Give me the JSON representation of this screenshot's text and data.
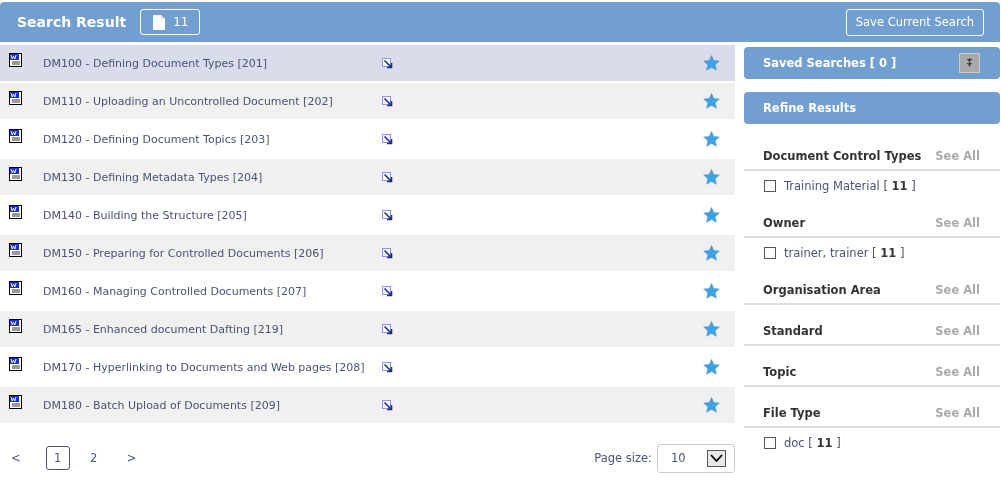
{
  "header": {
    "title": "Search Result",
    "count": "11",
    "save_button": "Save Current Search"
  },
  "results": [
    {
      "title": "DM100 - Defining Document Types [201]",
      "selected": true
    },
    {
      "title": "DM110 - Uploading an Uncontrolled Document [202]",
      "selected": false
    },
    {
      "title": "DM120 - Defining Document Topics [203]",
      "selected": false
    },
    {
      "title": "DM130 - Defining Metadata Types [204]",
      "selected": false
    },
    {
      "title": "DM140 - Building the Structure [205]",
      "selected": false
    },
    {
      "title": "DM150 - Preparing for Controlled Documents [206]",
      "selected": false
    },
    {
      "title": "DM160 - Managing Controlled Documents [207]",
      "selected": false
    },
    {
      "title": "DM165 - Enhanced document Dafting [219]",
      "selected": false
    },
    {
      "title": "DM170 - Hyperlinking to Documents and Web pages [208]",
      "selected": false
    },
    {
      "title": "DM180 - Batch Upload of Documents [209]",
      "selected": false
    }
  ],
  "pagination": {
    "prev": "<",
    "pages": [
      {
        "label": "1",
        "selected": true
      },
      {
        "label": "2",
        "selected": false
      }
    ],
    "next": ">",
    "page_size_label": "Page size:",
    "page_size": "10"
  },
  "saved_searches": {
    "title": "Saved Searches [ 0 ]"
  },
  "refine": {
    "title": "Refine Results",
    "facets": [
      {
        "title": "Document Control Types",
        "see_all": "See All",
        "options": [
          {
            "label": "Training Material [ **11** ]",
            "checked": false
          }
        ]
      },
      {
        "title": "Owner",
        "see_all": "See All",
        "options": [
          {
            "label": "trainer, trainer [ **11** ]",
            "checked": false
          }
        ]
      },
      {
        "title": "Organisation Area",
        "see_all": "See All"
      },
      {
        "title": "Standard",
        "see_all": "See All"
      },
      {
        "title": "Topic",
        "see_all": "See All"
      },
      {
        "title": "File Type",
        "see_all": "See All",
        "options": [
          {
            "label": "doc [ **11** ]",
            "checked": false
          }
        ]
      }
    ]
  }
}
